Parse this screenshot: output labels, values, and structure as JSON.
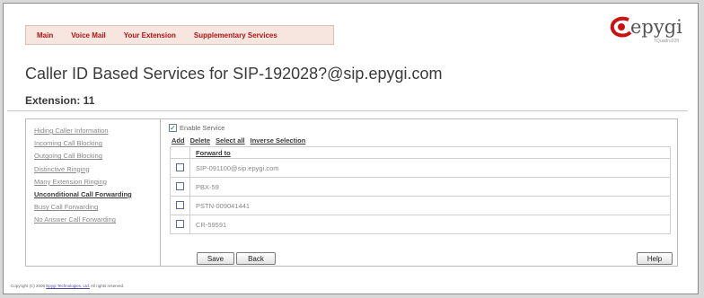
{
  "nav": {
    "items": [
      "Main",
      "Voice Mail",
      "Your Extension",
      "Supplementary Services"
    ]
  },
  "logo": {
    "wordmark": "epygi",
    "model": "TQuadro22ft"
  },
  "page": {
    "title": "Caller ID Based Services for SIP-192028?@sip.epygi.com",
    "extension": "Extension: 11"
  },
  "sidebar": {
    "items": [
      {
        "label": "Hiding Caller Information",
        "active": false
      },
      {
        "label": "Incoming Call Blocking",
        "active": false
      },
      {
        "label": "Outgoing Call Blocking",
        "active": false
      },
      {
        "label": "Distinctive Ringing",
        "active": false
      },
      {
        "label": "Many Extension Ringing",
        "active": false
      },
      {
        "label": "Unconditional Call Forwarding",
        "active": true
      },
      {
        "label": "Busy Call Forwarding",
        "active": false
      },
      {
        "label": "No Answer Call Forwarding",
        "active": false
      }
    ]
  },
  "service": {
    "enable_label": "Enable Service",
    "enable_checked": true
  },
  "actions": {
    "add": "Add",
    "delete": "Delete",
    "select_all": "Select all",
    "inverse": "Inverse Selection"
  },
  "table": {
    "header": "Forward to",
    "rows": [
      "SIP-091100@sip.epygi.com",
      "PBX-59",
      "PSTN-009041441",
      "CR-59591"
    ]
  },
  "buttons": {
    "save": "Save",
    "back": "Back",
    "help": "Help"
  },
  "footer": {
    "prefix": "Copyright (C) 2006 ",
    "company": "Epygi Technologies, Ltd.",
    "suffix": " All rights reserved."
  },
  "colors": {
    "nav_text": "#b31212",
    "logo_red": "#cc1111"
  }
}
